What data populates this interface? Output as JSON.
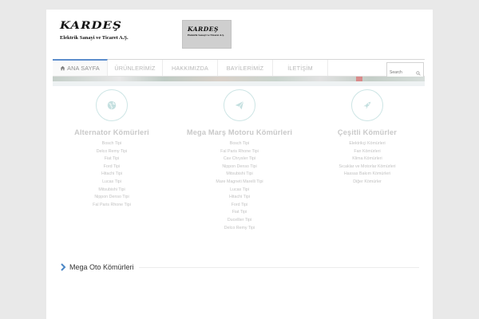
{
  "header": {
    "logo_brand": "KARDEŞ",
    "logo_subtitle": "Elektrik Sanayi ve Ticaret A.Ş.",
    "logo_box_brand": "KARDEŞ",
    "logo_box_subtitle": "Elektrik Sanayi ve Ticaret A.Ş."
  },
  "nav": {
    "items": [
      {
        "label": "ANA SAYFA",
        "active": true
      },
      {
        "label": "ÜRÜNLERİMİZ"
      },
      {
        "label": "HAKKIMIZDA"
      },
      {
        "label": "BAYİLERİMİZ"
      },
      {
        "label": "İLETİŞİM"
      }
    ],
    "search_placeholder": "Search"
  },
  "features": [
    {
      "icon": "globe-icon",
      "title": "Alternator Kömürleri",
      "items": [
        "Bosch Tipi",
        "Delco Remy Tipi",
        "Fiat Tipi",
        "Ford Tipi",
        "Hitachi Tipi",
        "Lucas Tipi",
        "Mitsubishi Tipi",
        "Nippon Denso Tipi",
        "Fal Paris Rhone Tipi"
      ]
    },
    {
      "icon": "paper-plane-icon",
      "title": "Mega Marş Motoru Kömürleri",
      "items": [
        "Bosch Tipi",
        "Fal Paris Rhone Tipi",
        "Cav Chrysler Tipi",
        "Nippon Denso Tipi",
        "Mitsubishi Tipi",
        "Mare Magneti Marelli Tipi",
        "Lucas Tipi",
        "Hitachi Tipi",
        "Ford Tipi",
        "Fiat Tipi",
        "Ducellier Tipi",
        "Delco Remy Tipi"
      ]
    },
    {
      "icon": "rocket-icon",
      "title": "Çeşitli Kömürler",
      "items": [
        "Elektrikçi Kömürleri",
        "Fan Kömürleri",
        "Klima Kömürleri",
        "Sıcaklar ve Motorlar Kömürleri",
        "Hassas Bakım Kömürleri",
        "Diğer Kömürler"
      ]
    }
  ],
  "section": {
    "title": "Mega Oto Kömürleri"
  },
  "colors": {
    "nav_active_border": "#5d8ecc",
    "icon_circle": "#cde5e5",
    "section_chevron": "#4a86c5"
  }
}
